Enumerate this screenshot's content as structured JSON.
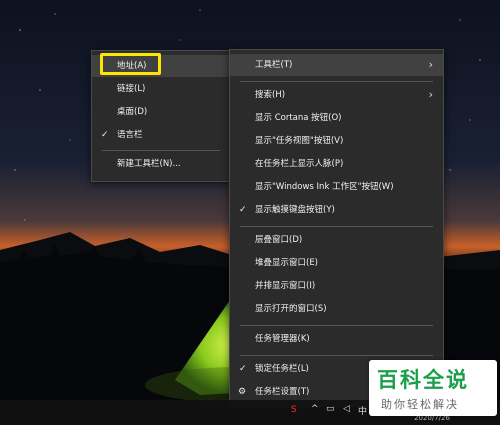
{
  "toolbars_submenu": {
    "items": [
      {
        "label": "地址(A)",
        "checked": false,
        "highlighted": true
      },
      {
        "label": "链接(L)",
        "checked": false
      },
      {
        "label": "桌面(D)",
        "checked": false
      },
      {
        "label": "语言栏",
        "checked": true
      },
      {
        "label": "新建工具栏(N)...",
        "checked": false
      }
    ],
    "highlight_color": "#ffe600"
  },
  "taskbar_menu": {
    "toolbars": "工具栏(T)",
    "search": "搜索(H)",
    "cortana": "显示 Cortana 按钮(O)",
    "task_view": "显示\"任务视图\"按钮(V)",
    "people": "在任务栏上显示人脉(P)",
    "windows_ink": "显示\"Windows Ink 工作区\"按钮(W)",
    "touch_keyboard": "显示触摸键盘按钮(Y)",
    "cascade": "层叠窗口(D)",
    "stacked": "堆叠显示窗口(E)",
    "side_by_side": "并排显示窗口(I)",
    "show_desktop": "显示打开的窗口(S)",
    "task_manager": "任务管理器(K)",
    "lock_taskbar": "锁定任务栏(L)",
    "settings": "任务栏设置(T)"
  },
  "taskbar": {
    "date": "2020/7/26"
  },
  "watermark": {
    "title": "百科全说",
    "subtitle": "助你轻松解决"
  },
  "icons": [
    "chevron-right-icon",
    "checkmark-icon",
    "gear-icon",
    "network-icon",
    "volume-icon",
    "ime-icon",
    "sogou-icon",
    "notification-icon"
  ],
  "colors": {
    "menu_bg": "#2b2b2b",
    "menu_hover": "#414141",
    "brand_green": "#1a9f4b"
  }
}
